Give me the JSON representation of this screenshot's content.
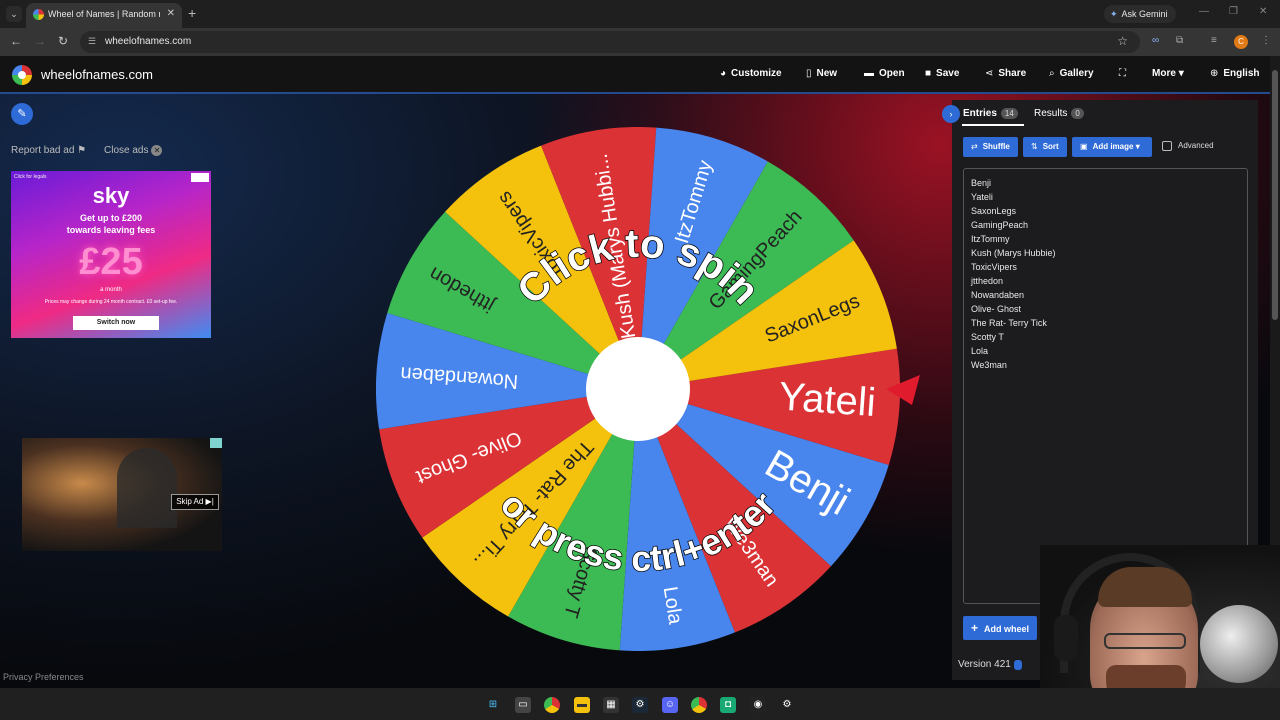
{
  "browser": {
    "tab_title": "Wheel of Names | Random name",
    "ask_gemini": "Ask Gemini",
    "url": "wheelofnames.com"
  },
  "site": {
    "name": "wheelofnames.com",
    "nav": {
      "customize": "Customize",
      "new": "New",
      "open": "Open",
      "save": "Save",
      "share": "Share",
      "gallery": "Gallery",
      "more": "More",
      "language": "English"
    }
  },
  "ads": {
    "report": "Report bad ad",
    "close": "Close ads",
    "banner": {
      "small_text": "Click for legals",
      "logo": "sky",
      "headline1": "Get up to £200",
      "headline2": "towards leaving fees",
      "price": "£25",
      "month": "a month",
      "fine_print": "Prices may change during 24 month contract. £0 set-up fee.",
      "button": "Switch now"
    },
    "skip": "Skip Ad ▶|"
  },
  "privacy": "Privacy Preferences",
  "wheel": {
    "prompt_top": "Click to spin",
    "prompt_bottom": "or press ctrl+enter",
    "segments": [
      {
        "label": "Yateli",
        "color": "#db3236"
      },
      {
        "label": "Benji",
        "color": "#4885ed"
      },
      {
        "label": "We3man",
        "color": "#db3236"
      },
      {
        "label": "Lola",
        "color": "#4885ed"
      },
      {
        "label": "Scotty T",
        "color": "#3cba54"
      },
      {
        "label": "The Rat- Terry Ti...",
        "color": "#f4c20d"
      },
      {
        "label": "Olive- Ghost",
        "color": "#db3236"
      },
      {
        "label": "Nowandaben",
        "color": "#4885ed"
      },
      {
        "label": "jtthedon",
        "color": "#3cba54"
      },
      {
        "label": "ToxicVipers",
        "color": "#f4c20d"
      },
      {
        "label": "Kush (Marys Hubbi...",
        "color": "#db3236"
      },
      {
        "label": "ItzTommy",
        "color": "#4885ed"
      },
      {
        "label": "GamingPeach",
        "color": "#3cba54"
      },
      {
        "label": "SaxonLegs",
        "color": "#f4c20d"
      }
    ]
  },
  "sidebar": {
    "entries_tab": "Entries",
    "entries_count": "14",
    "results_tab": "Results",
    "results_count": "0",
    "shuffle": "Shuffle",
    "sort": "Sort",
    "add_image": "Add image",
    "advanced": "Advanced",
    "entries": [
      "Benji",
      "Yateli",
      "SaxonLegs",
      "GamingPeach",
      "ItzTommy",
      "Kush (Marys Hubbie)",
      "ToxicVipers",
      "jtthedon",
      "Nowandaben",
      "Olive- Ghost",
      "The Rat- Terry Tick",
      "Scotty T",
      "Lola",
      "We3man"
    ],
    "add_wheel": "Add wheel",
    "version": "Version 421"
  }
}
